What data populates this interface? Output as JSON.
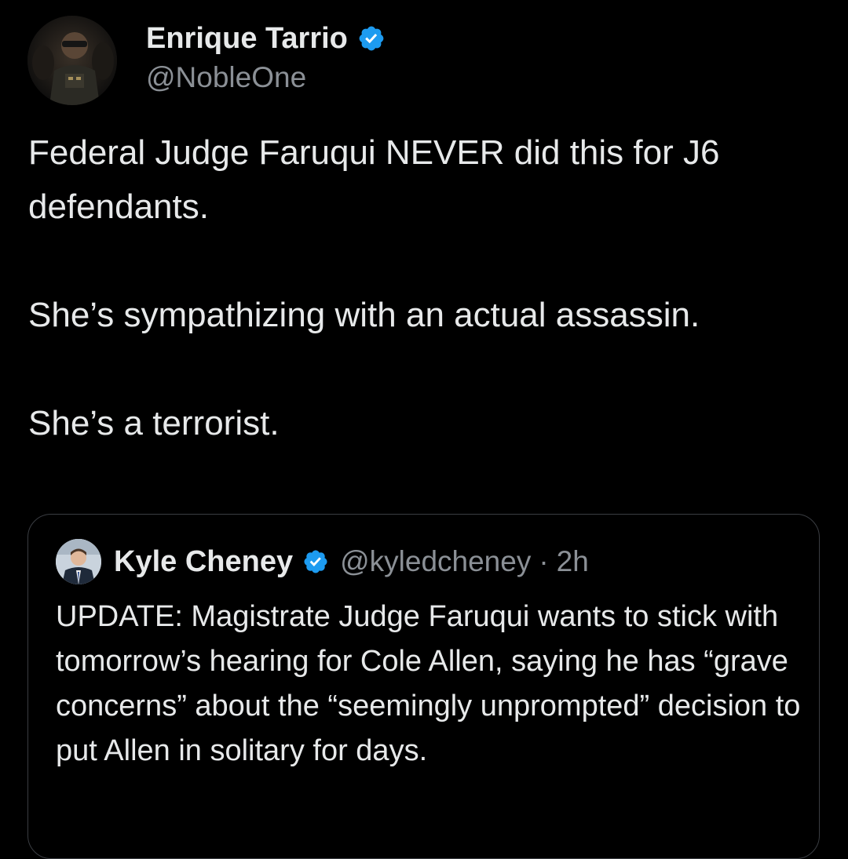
{
  "tweet": {
    "author": {
      "display_name": "Enrique Tarrio",
      "handle": "@NobleOne",
      "verified": true
    },
    "paragraphs": [
      "Federal Judge Faruqui NEVER did this for J6 defendants.",
      "She’s sympathizing with an actual assassin.",
      "She’s a terrorist."
    ]
  },
  "quoted_tweet": {
    "author": {
      "display_name": "Kyle Cheney",
      "handle": "@kyledcheney",
      "verified": true
    },
    "separator": "·",
    "time": "2h",
    "text": "UPDATE: Magistrate Judge Faruqui wants to stick with tomorrow’s hearing for Cole Allen, saying he has “grave concerns” about the “seemingly unprompted” decision to put Allen in solitary for days."
  },
  "colors": {
    "background": "#000000",
    "text_primary": "#e7e9ea",
    "text_secondary": "#8b9096",
    "verified_badge": "#1d9bf0",
    "card_border": "#3a3d42"
  },
  "icons": {
    "verified": "verified-badge-icon",
    "avatar_main": "profile-photo",
    "avatar_quote": "profile-photo"
  }
}
